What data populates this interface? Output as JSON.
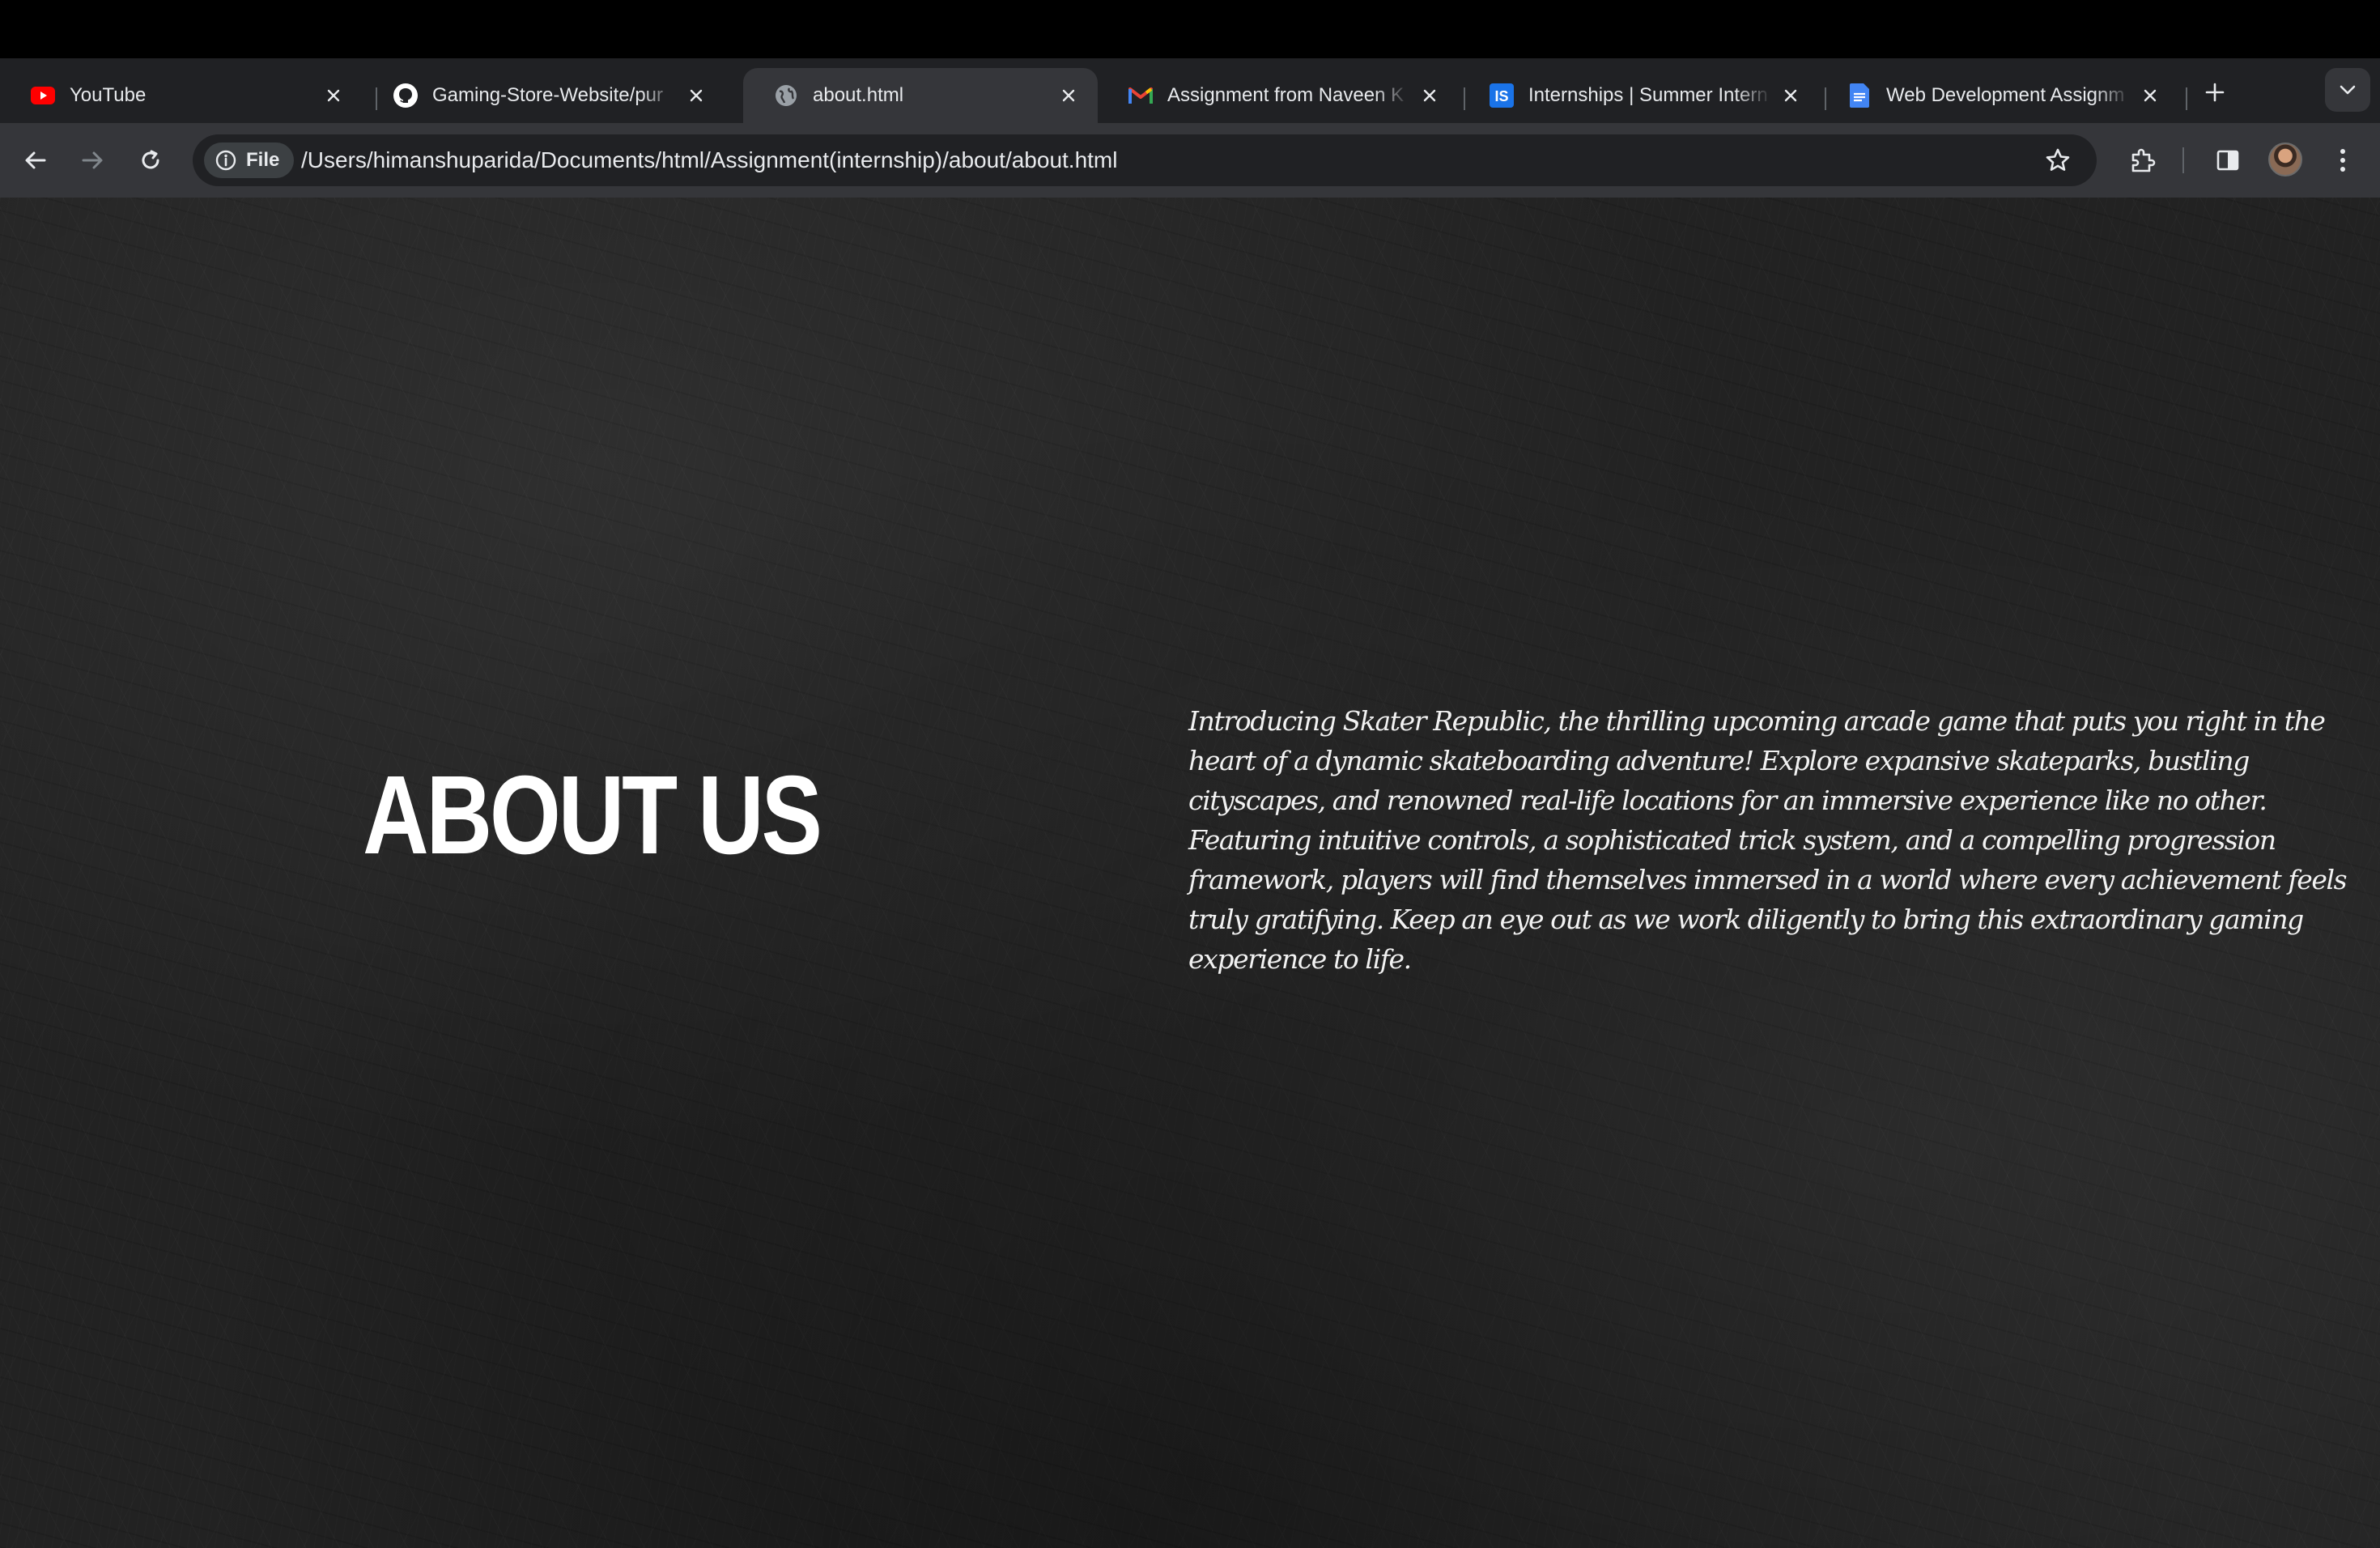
{
  "browser": {
    "tabs": [
      {
        "title": "YouTube",
        "icon": "youtube-icon",
        "active": false
      },
      {
        "title": "Gaming-Store-Website/pur",
        "icon": "github-icon",
        "active": false
      },
      {
        "title": "about.html",
        "icon": "globe-icon",
        "active": true
      },
      {
        "title": "Assignment from Naveen K",
        "icon": "gmail-icon",
        "active": false
      },
      {
        "title": "Internships | Summer Intern",
        "icon": "internshala-icon",
        "active": false
      },
      {
        "title": "Web Development Assignm",
        "icon": "google-docs-icon",
        "active": false
      }
    ],
    "address_bar": {
      "chip_label": "File",
      "url": "/Users/himanshuparida/Documents/html/Assignment(internship)/about/about.html"
    },
    "colors": {
      "youtube": "#ff0000",
      "gmail_red": "#ea4335",
      "internshala": "#1a73e8",
      "docs": "#4285f4"
    }
  },
  "page": {
    "heading": "ABOUT US",
    "body": "Introducing Skater Republic, the thrilling upcoming arcade game that puts you right in the heart of a dynamic skateboarding adventure! Explore expansive skateparks, bustling cityscapes, and renowned real-life locations for an immersive experience like no other. Featuring intuitive controls, a sophisticated trick system, and a compelling progression framework, players will find themselves immersed in a world where every achievement feels truly gratifying. Keep an eye out as we work diligently to bring this extraordinary gaming experience to life."
  }
}
